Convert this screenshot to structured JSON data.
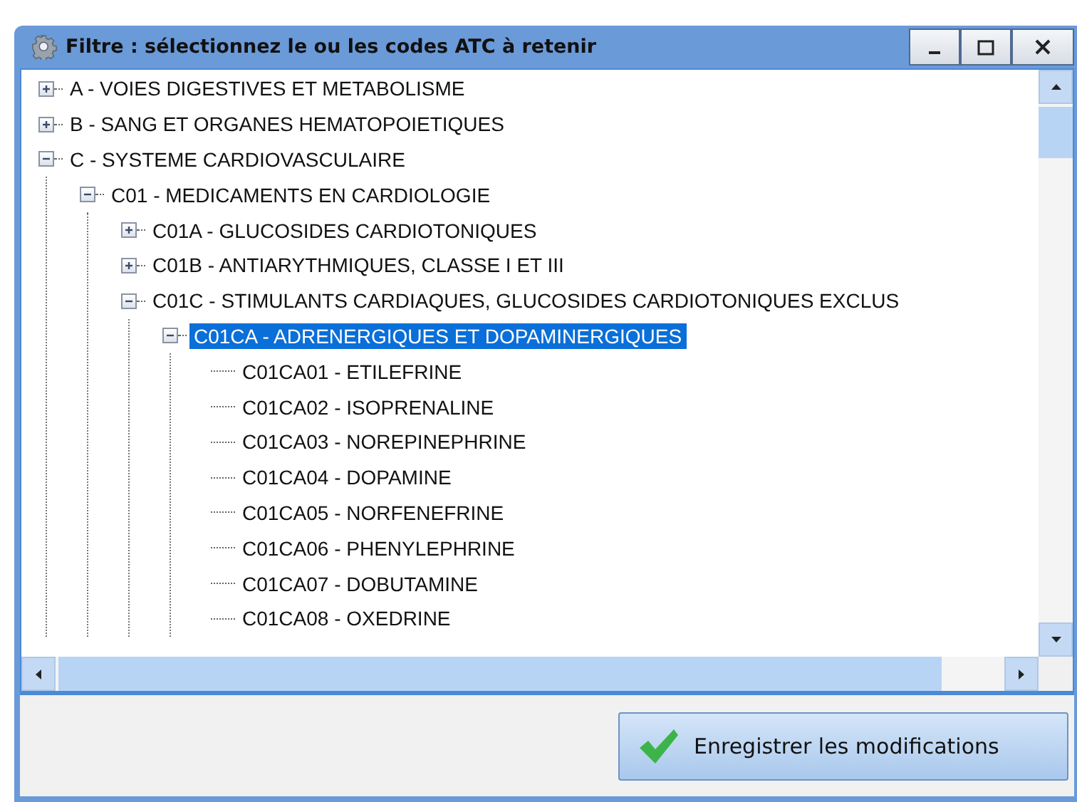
{
  "window": {
    "title": "Filtre : sélectionnez le ou les codes ATC à retenir"
  },
  "tree": [
    {
      "label": "A - VOIES DIGESTIVES ET METABOLISME",
      "expanded": false,
      "selected": false
    },
    {
      "label": "B - SANG ET ORGANES HEMATOPOIETIQUES",
      "expanded": false,
      "selected": false
    },
    {
      "label": "C - SYSTEME CARDIOVASCULAIRE",
      "expanded": true,
      "selected": false,
      "children": [
        {
          "label": "C01 - MEDICAMENTS EN CARDIOLOGIE",
          "expanded": true,
          "selected": false,
          "children": [
            {
              "label": "C01A - GLUCOSIDES CARDIOTONIQUES",
              "expanded": false,
              "selected": false
            },
            {
              "label": "C01B - ANTIARYTHMIQUES, CLASSE I ET III",
              "expanded": false,
              "selected": false
            },
            {
              "label": "C01C - STIMULANTS CARDIAQUES, GLUCOSIDES CARDIOTONIQUES EXCLUS",
              "expanded": true,
              "selected": false,
              "children": [
                {
                  "label": "C01CA - ADRENERGIQUES ET DOPAMINERGIQUES",
                  "expanded": true,
                  "selected": true,
                  "children": [
                    {
                      "label": "C01CA01 - ETILEFRINE",
                      "selected": false
                    },
                    {
                      "label": "C01CA02 - ISOPRENALINE",
                      "selected": false
                    },
                    {
                      "label": "C01CA03 - NOREPINEPHRINE",
                      "selected": false
                    },
                    {
                      "label": "C01CA04 - DOPAMINE",
                      "selected": false
                    },
                    {
                      "label": "C01CA05 - NORFENEFRINE",
                      "selected": false
                    },
                    {
                      "label": "C01CA06 - PHENYLEPHRINE",
                      "selected": false
                    },
                    {
                      "label": "C01CA07 - DOBUTAMINE",
                      "selected": false
                    },
                    {
                      "label": "C01CA08 - OXEDRINE",
                      "selected": false
                    }
                  ]
                }
              ]
            }
          ]
        }
      ]
    }
  ],
  "save_button": {
    "label": "Enregistrer les modifications"
  }
}
